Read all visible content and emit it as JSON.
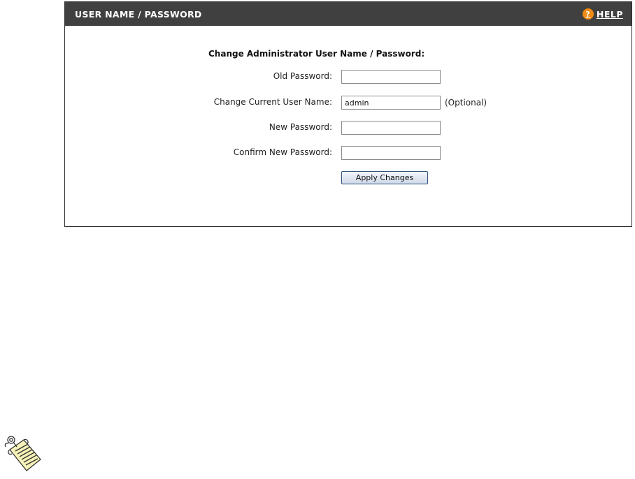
{
  "panel": {
    "title": "USER NAME / PASSWORD",
    "help": {
      "icon": "?",
      "label": "HELP"
    }
  },
  "form": {
    "heading": "Change Administrator User Name / Password:",
    "fields": [
      {
        "label": "Old Password:",
        "value": ""
      },
      {
        "label": "Change Current User Name:",
        "value": "admin",
        "note": "(Optional)"
      },
      {
        "label": "New Password:",
        "value": ""
      },
      {
        "label": "Confirm New Password:",
        "value": ""
      }
    ],
    "apply_label": "Apply Changes"
  },
  "icons": {
    "help": "question-circle-icon",
    "note": "notepad-scroll-icon"
  },
  "colors": {
    "header_bg": "#404040",
    "help_icon": "#f08a12",
    "button_border": "#2f4f7a"
  }
}
